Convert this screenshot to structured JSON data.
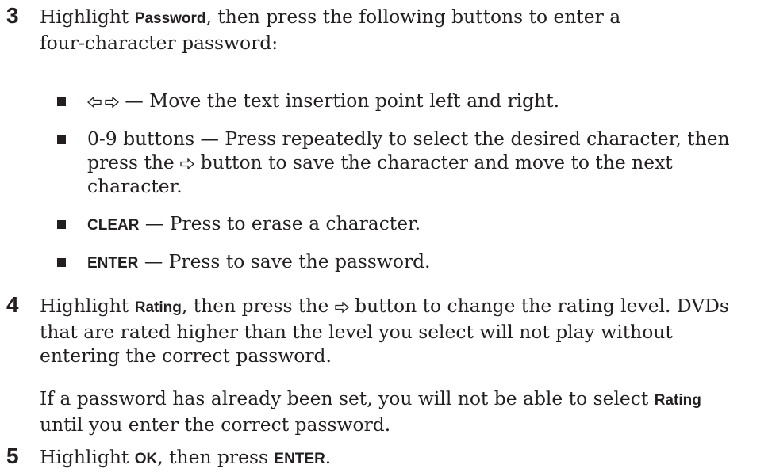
{
  "steps": [
    {
      "number": "3",
      "line1_pre": "Highlight ",
      "line1_key": "Password",
      "line1_post": ", then press the following buttons to enter a",
      "line2": "four-character password:",
      "bullets": [
        {
          "text_after_icon": " — Move the text insertion point left and right."
        },
        {
          "line1": "0-9 buttons — Press repeatedly to select the desired character, then",
          "line2_pre": "press the ",
          "line2_post": " button to save the character and move to the next",
          "line3": "character."
        },
        {
          "key": "CLEAR",
          "text": " — Press to erase a character."
        },
        {
          "key": "ENTER",
          "text": " — Press to save the password."
        }
      ]
    },
    {
      "number": "4",
      "line1_pre": "Highlight ",
      "line1_key": "Rating",
      "line1_mid": ", then press the ",
      "line1_post": " button to change the rating level. DVDs",
      "line2": "that are rated higher than the level you select will not play without",
      "line3": "entering the correct password.",
      "note_line1_pre": "If a password has already been set, you will not be able to select ",
      "note_line1_key": "Rating",
      "note_line2": "until you enter the correct password."
    },
    {
      "number": "5",
      "line1_pre": "Highlight ",
      "line1_key": "OK",
      "line1_mid": ", then press ",
      "line1_key2": "ENTER",
      "line1_post": "."
    }
  ],
  "icons": {
    "left_arrow": "left-arrow-outline-icon",
    "right_arrow": "right-arrow-outline-icon"
  },
  "colors": {
    "text": "#231f20",
    "background": "#ffffff"
  }
}
